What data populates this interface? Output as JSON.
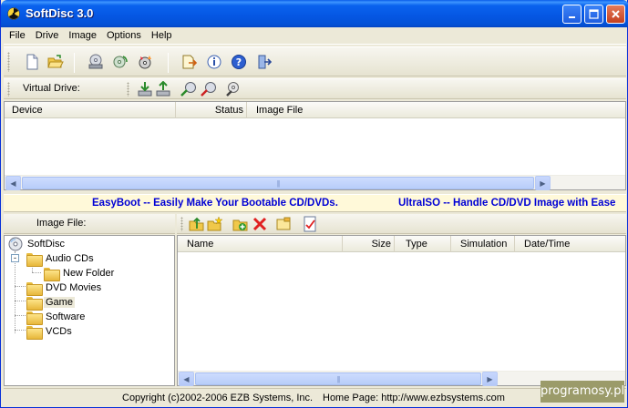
{
  "window": {
    "title": "SoftDisc 3.0"
  },
  "menu": [
    "File",
    "Drive",
    "Image",
    "Options",
    "Help"
  ],
  "toolbar2": {
    "virtual_drive_label": "Virtual Drive:"
  },
  "device_list": {
    "columns": [
      "Device",
      "Status",
      "Image File"
    ]
  },
  "banner": {
    "left": "EasyBoot -- Easily Make Your Bootable CD/DVDs.",
    "right": "UltraISO -- Handle CD/DVD Image with Ease"
  },
  "left_panel": {
    "header": "Image File:"
  },
  "tree": {
    "root": "SoftDisc",
    "items": [
      "Audio CDs",
      "New Folder",
      "DVD Movies",
      "Game",
      "Software",
      "VCDs"
    ]
  },
  "file_list": {
    "columns": [
      "Name",
      "Size",
      "Type",
      "Simulation",
      "Date/Time"
    ]
  },
  "status": {
    "copyright": "Copyright (c)2002-2006 EZB Systems, Inc.",
    "homepage": "Home Page: http://www.ezbsystems.com"
  },
  "watermark": "programosy.pl",
  "colors": {
    "titlebar": "#0a5ee9",
    "banner_text": "#0000d5",
    "banner_bg": "#fff9d9"
  }
}
